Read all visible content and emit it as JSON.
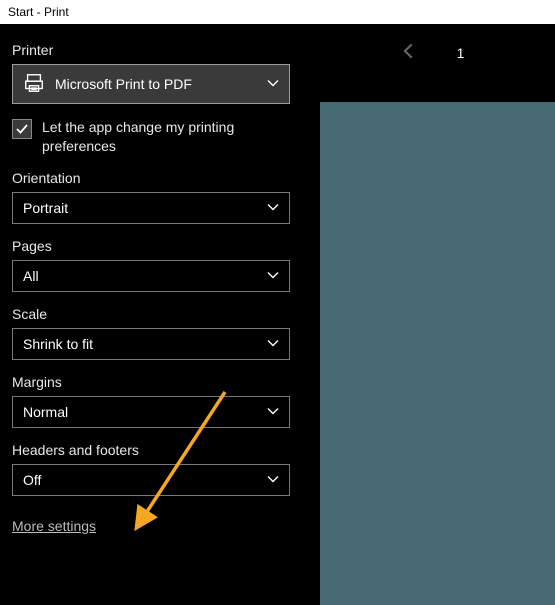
{
  "titlebar": "Start - Print",
  "printer": {
    "label": "Printer",
    "selected": "Microsoft Print to PDF"
  },
  "checkbox": {
    "label": "Let the app change my printing preferences"
  },
  "orientation": {
    "label": "Orientation",
    "selected": "Portrait"
  },
  "pages": {
    "label": "Pages",
    "selected": "All"
  },
  "scale": {
    "label": "Scale",
    "selected": "Shrink to fit"
  },
  "margins": {
    "label": "Margins",
    "selected": "Normal"
  },
  "headers_footers": {
    "label": "Headers and footers",
    "selected": "Off"
  },
  "more_settings_label": "More settings",
  "pager": {
    "current": "1"
  }
}
